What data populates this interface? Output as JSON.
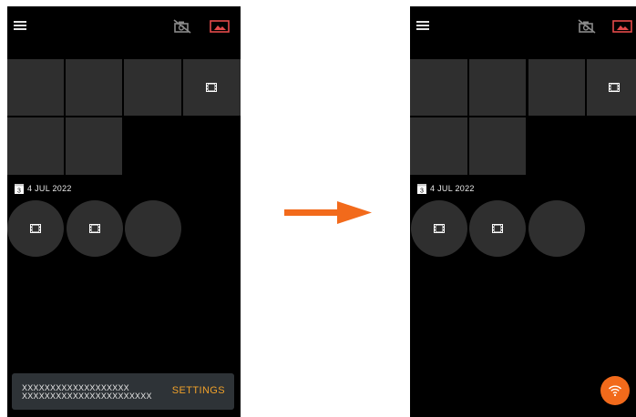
{
  "left_screen": {
    "date": "4 JUL 2022",
    "calendar_day": "3",
    "snackbar": {
      "line1": "XXXXXXXXXXXXXXXXXXX",
      "line2": "XXXXXXXXXXXXXXXXXXXXXXX",
      "action": "SETTINGS"
    }
  },
  "right_screen": {
    "date": "4 JUL 2022",
    "calendar_day": "3"
  },
  "colors": {
    "screen_bg": "#000000",
    "tile": "#2f2f2f",
    "snackbar_bg": "#2e3337",
    "accent_orange": "#f26a1b",
    "action_text": "#f0a12a",
    "camera_off_icon": "#8a8a8a",
    "gallery_icon": "#e34a4a"
  },
  "icons": {
    "menu": "hamburger-menu-icon",
    "camera_off": "no-camera-icon",
    "gallery": "gallery-icon",
    "video": "film-icon",
    "calendar": "calendar-icon",
    "wifi": "wifi-icon",
    "transition": "arrow-right-icon"
  }
}
